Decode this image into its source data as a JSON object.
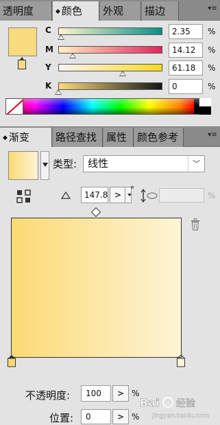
{
  "color_panel": {
    "tabs": [
      {
        "label": "透明度",
        "active": false
      },
      {
        "label": "颜色",
        "active": true,
        "arrows": "◆"
      },
      {
        "label": "外观",
        "active": false
      },
      {
        "label": "描边",
        "active": false
      }
    ],
    "menu_icon": "panel-menu-icon",
    "current_fill": "#f8da7f",
    "channels": [
      {
        "label": "C",
        "value": "2.35",
        "unit": "%",
        "level_percent": 2.35,
        "gradient_from": "#fff4cc",
        "gradient_to": "#0a8f8a"
      },
      {
        "label": "M",
        "value": "14.12",
        "unit": "%",
        "level_percent": 14.12,
        "gradient_from": "#fff1c0",
        "gradient_to": "#e0245e"
      },
      {
        "label": "Y",
        "value": "61.18",
        "unit": "%",
        "level_percent": 61.18,
        "gradient_from": "#fbf2f6",
        "gradient_to": "#f7dc1e"
      },
      {
        "label": "K",
        "value": "0",
        "unit": "%",
        "level_percent": 0,
        "gradient_from": "#fbdc7a",
        "gradient_to": "#151515"
      }
    ]
  },
  "gradient_panel": {
    "tabs": [
      {
        "label": "渐变",
        "active": true,
        "arrows": "◆"
      },
      {
        "label": "路径查找",
        "active": false
      },
      {
        "label": "属性",
        "active": false
      },
      {
        "label": "颜色参考",
        "active": false
      }
    ],
    "type_label": "类型:",
    "type_value": "线性",
    "angle_value": "147.8",
    "angle_unit": "°",
    "aspect_unit": "%",
    "start_color": "#fbda74",
    "end_color": "#fef4d6",
    "opacity_label": "不透明度:",
    "opacity_value": "100",
    "opacity_unit": "%",
    "location_label": "位置:",
    "location_value": "0",
    "location_unit": "%",
    "stepper_glyph": ">"
  },
  "watermark": {
    "text": "Bai 经验",
    "sub": "jingyan.baidu.com"
  }
}
